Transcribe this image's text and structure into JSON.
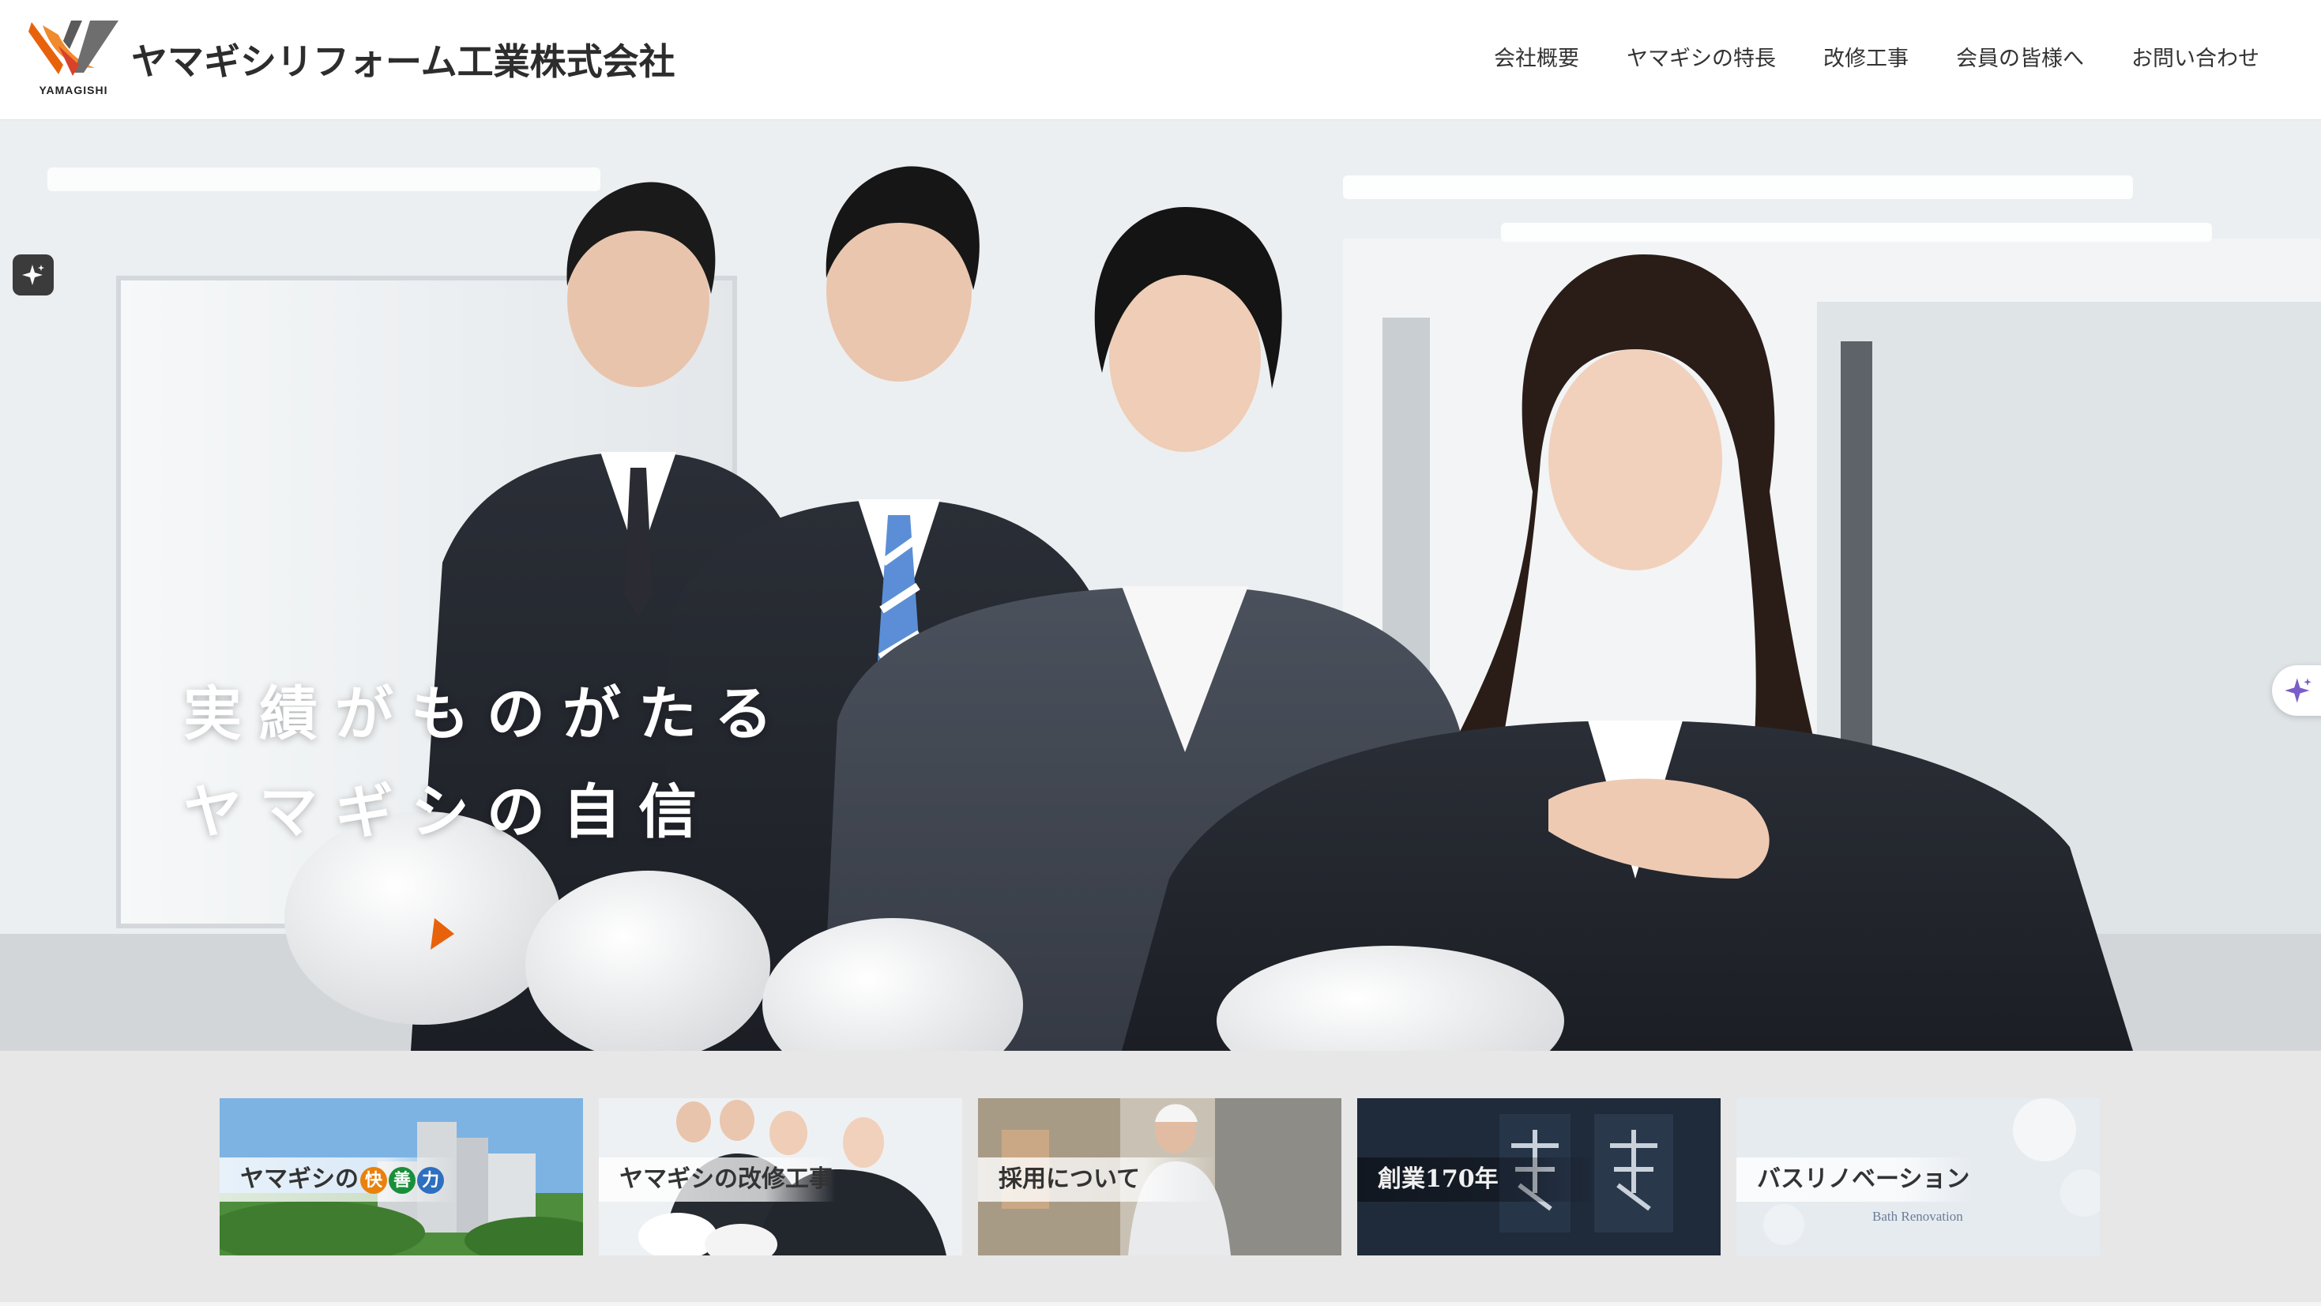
{
  "header": {
    "logo_subtext": "YAMAGISHI",
    "company_name": "ヤマギシリフォーム工業株式会社",
    "nav": [
      {
        "label": "会社概要"
      },
      {
        "label": "ヤマギシの特長"
      },
      {
        "label": "改修工事"
      },
      {
        "label": "会員の皆様へ"
      },
      {
        "label": "お問い合わせ"
      }
    ]
  },
  "hero": {
    "headline_line1": "実績がものがたる",
    "headline_line2": "ヤマギシの自信"
  },
  "banners": [
    {
      "label_prefix": "ヤマギシの",
      "pills": [
        "快",
        "善",
        "力"
      ],
      "pill_colors": [
        "#e8820c",
        "#1a8f3a",
        "#2f6fbf"
      ]
    },
    {
      "label": "ヤマギシの改修工事",
      "active": true
    },
    {
      "label": "採用について"
    },
    {
      "label": "創業170年"
    },
    {
      "label": "バスリノベーション",
      "caption": "Bath Renovation"
    }
  ],
  "colors": {
    "accent_orange": "#ef7f22",
    "logo_orange": "#e8620c",
    "text_dark": "#333333"
  },
  "icons": [
    "sparkle-icon",
    "sparkle-icon"
  ]
}
